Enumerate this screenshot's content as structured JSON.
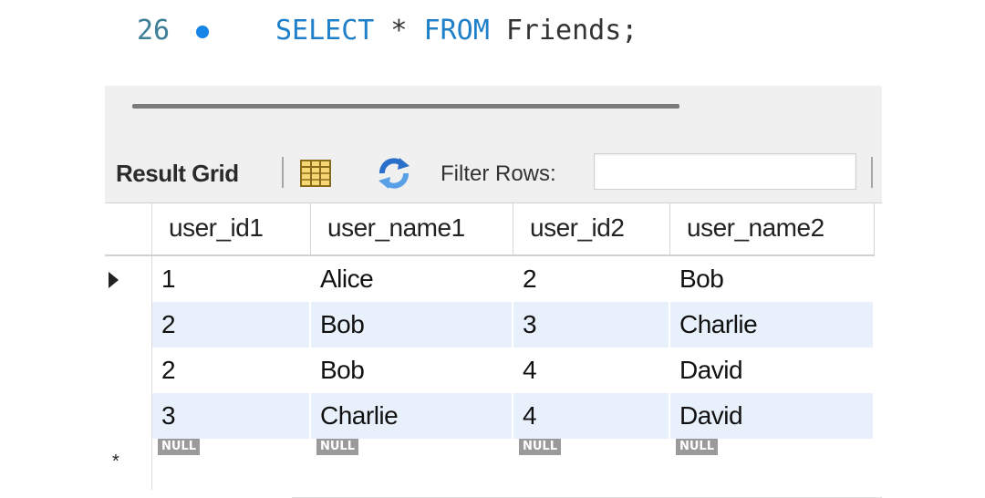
{
  "editor": {
    "line_number": "26",
    "sql": [
      {
        "text": "SELECT",
        "kind": "keyword"
      },
      {
        "text": " * ",
        "kind": "plain"
      },
      {
        "text": "FROM",
        "kind": "keyword"
      },
      {
        "text": " Friends;",
        "kind": "plain"
      }
    ]
  },
  "toolbar": {
    "result_grid_label": "Result Grid",
    "grid_icon": "grid-layout-icon",
    "refresh_icon": "refresh-icon",
    "filter_label": "Filter Rows:",
    "filter_value": ""
  },
  "table": {
    "columns": [
      "user_id1",
      "user_name1",
      "user_id2",
      "user_name2"
    ],
    "rows": [
      [
        "1",
        "Alice",
        "2",
        "Bob"
      ],
      [
        "2",
        "Bob",
        "3",
        "Charlie"
      ],
      [
        "2",
        "Bob",
        "4",
        "David"
      ],
      [
        "3",
        "Charlie",
        "4",
        "David"
      ]
    ],
    "null_label": "NULL",
    "new_row_marker": "*"
  },
  "colors": {
    "keyword": "#1f7fc8",
    "breakpoint": "#1585e8",
    "alt_row": "#e8f0fb"
  }
}
